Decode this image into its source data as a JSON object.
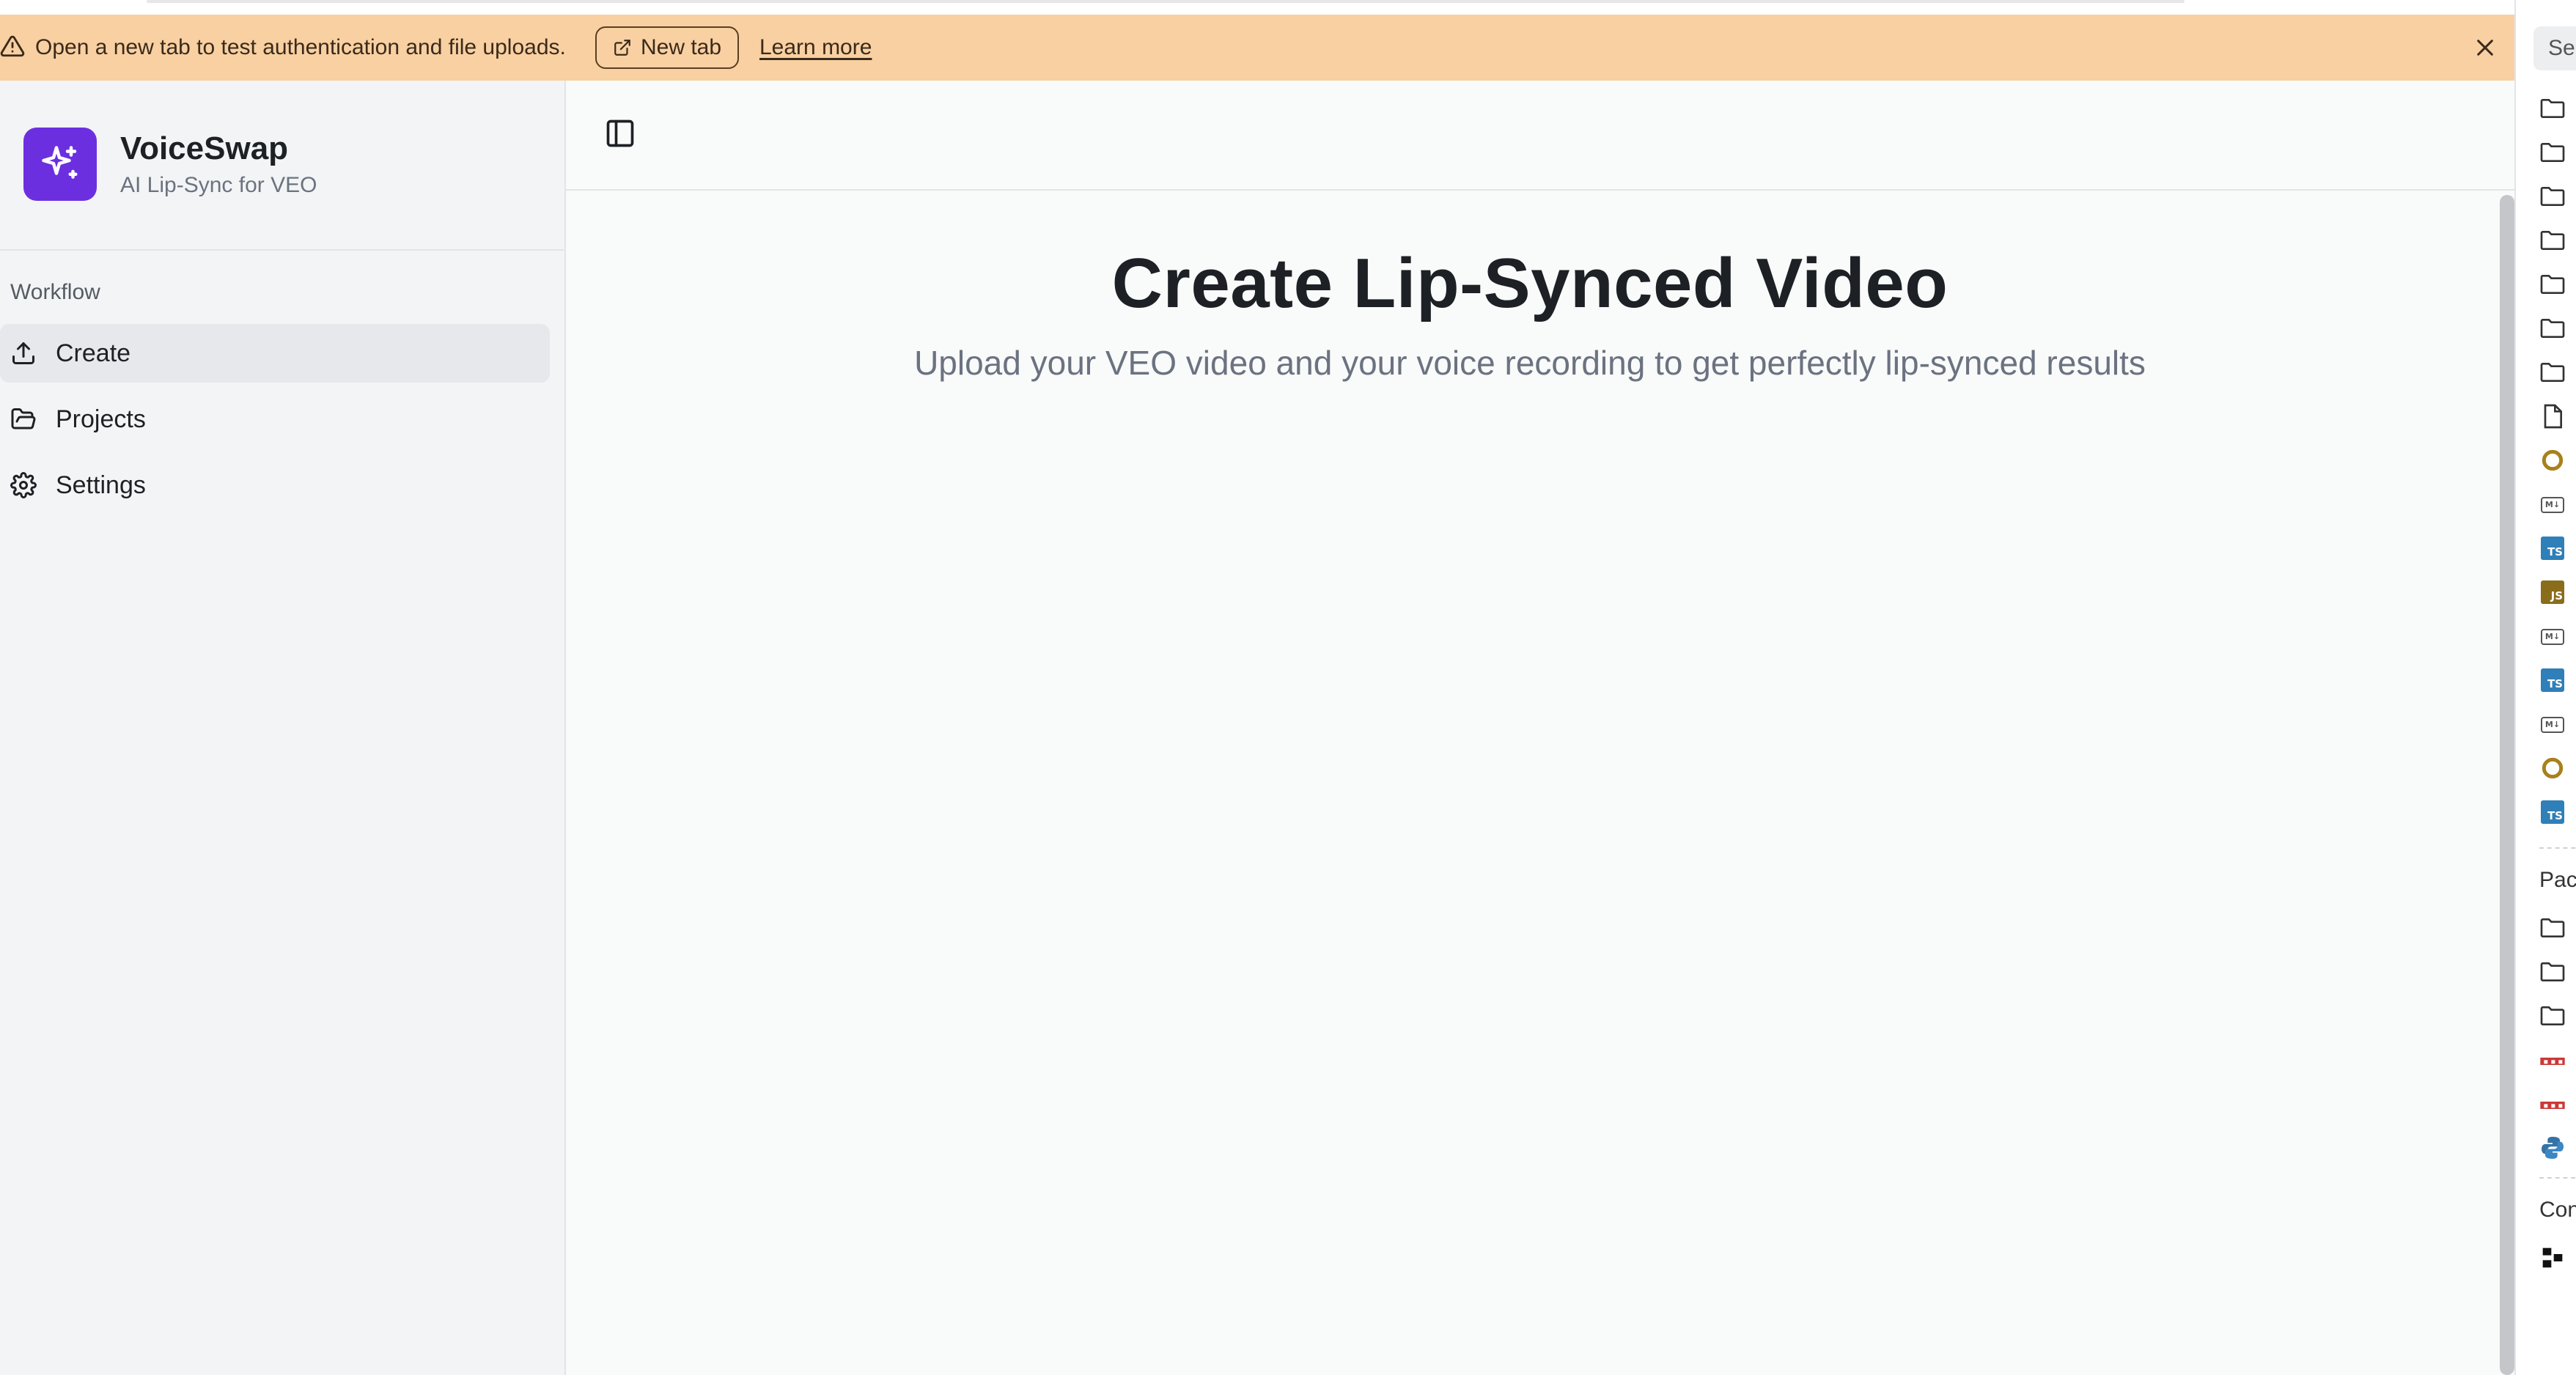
{
  "banner": {
    "message": "Open a new tab to test authentication and file uploads.",
    "new_tab_label": "New tab",
    "learn_more_label": "Learn more"
  },
  "brand": {
    "name": "VoiceSwap",
    "subtitle": "AI Lip-Sync for VEO"
  },
  "sidebar": {
    "group_label": "Workflow",
    "items": [
      {
        "label": "Create",
        "icon": "upload-icon",
        "active": true
      },
      {
        "label": "Projects",
        "icon": "folder-open-icon",
        "active": false
      },
      {
        "label": "Settings",
        "icon": "gear-icon",
        "active": false
      }
    ]
  },
  "main": {
    "title": "Create Lip-Synced Video",
    "subtitle": "Upload your VEO video and your voice recording to get perfectly lip-synced results"
  },
  "right_panel": {
    "search_partial": "Sea",
    "section_packages_partial": "Pac",
    "section_con_partial": "Con"
  },
  "colors": {
    "banner_bg": "#f8d0a2",
    "brand_accent": "#6c2fe0",
    "ts_badge": "#2f7fb8",
    "js_badge": "#8a6d1a",
    "npm_red": "#cb3837"
  }
}
